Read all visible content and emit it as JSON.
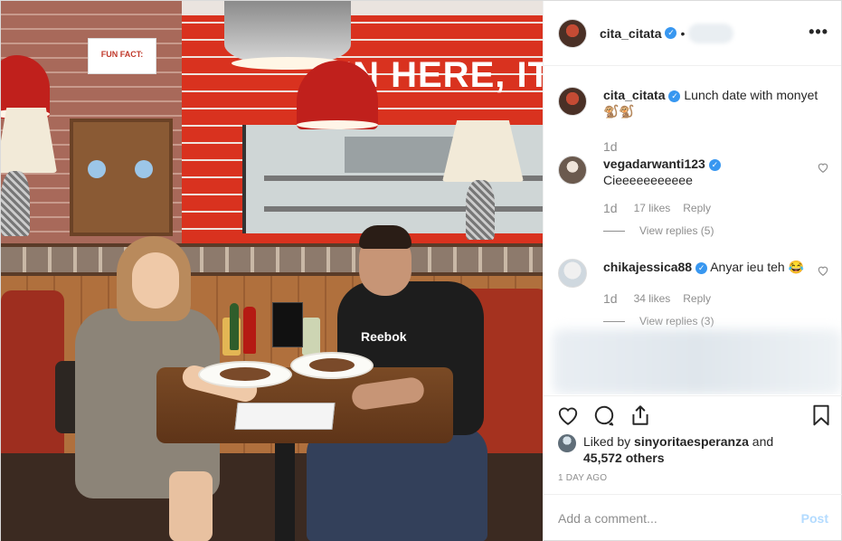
{
  "post": {
    "image_sign": {
      "fun_card": "FUN FACT:",
      "wall_text": "IN HERE, IT'S A",
      "shirt_logo": "Reebok"
    },
    "header": {
      "username": "cita_citata",
      "verified": true,
      "separator": "•",
      "more_label": "•••"
    },
    "caption": {
      "username": "cita_citata",
      "text": "Lunch date with monyet 🐒🐒",
      "age": "1d"
    },
    "comments": [
      {
        "username": "vegadarwanti123",
        "verified": true,
        "text": "Cieeeeeeeeeee",
        "age": "1d",
        "likes": "17 likes",
        "reply": "Reply",
        "view_replies": "View replies (5)"
      },
      {
        "username": "chikajessica88",
        "verified": true,
        "text": "Anyar ieu teh 😂",
        "age": "1d",
        "likes": "34 likes",
        "reply": "Reply",
        "view_replies": "View replies (3)"
      }
    ],
    "liked_by": {
      "prefix": "Liked by ",
      "user": "sinyoritaesperanza",
      "mid": " and",
      "others": "45,572 others"
    },
    "timestamp": "1 DAY AGO",
    "add_comment": {
      "placeholder": "Add a comment...",
      "post_label": "Post"
    },
    "icons": [
      "heart-icon",
      "comment-icon",
      "share-icon",
      "bookmark-icon",
      "more-icon",
      "verified-badge-icon"
    ],
    "colors": {
      "verified": "#3897f0",
      "post_button_disabled": "#b3dbff",
      "muted_text": "#8e8e8e"
    }
  }
}
